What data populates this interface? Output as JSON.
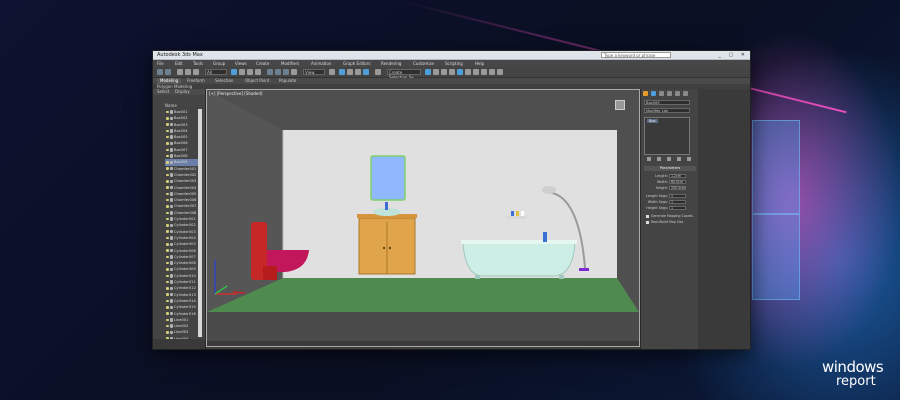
{
  "app": {
    "title": "Autodesk 3ds Max",
    "search_placeholder": "Type a keyword or phrase",
    "window_buttons": "_ ▢ ✕"
  },
  "menubar": [
    "File",
    "Edit",
    "Tools",
    "Group",
    "Views",
    "Create",
    "Modifiers",
    "Animation",
    "Graph Editors",
    "Rendering",
    "Customize",
    "Scripting",
    "Help"
  ],
  "toolbar": {
    "filter_dropdown": "All",
    "view_dropdown": "View",
    "selection_set_dropdown": "Create Selection Se"
  },
  "ribbon": {
    "tabs": [
      "Modeling",
      "Freeform",
      "Selection",
      "Object Paint",
      "Populate"
    ],
    "active": "Modeling",
    "sub": "Polygon Modeling"
  },
  "explorer": {
    "tabs": [
      "Select",
      "Display"
    ],
    "header": "Name",
    "items": [
      "Box001",
      "Box002",
      "Box003",
      "Box004",
      "Box005",
      "Box006",
      "Box007",
      "Box008",
      "Box009",
      "Chamfer001",
      "Chamfer002",
      "Chamfer003",
      "Chamfer004",
      "Chamfer005",
      "Chamfer006",
      "Chamfer007",
      "Chamfer008",
      "Cylinder001",
      "Cylinder002",
      "Cylinder003",
      "Cylinder004",
      "Cylinder005",
      "Cylinder006",
      "Cylinder007",
      "Cylinder008",
      "Cylinder009",
      "Cylinder010",
      "Cylinder011",
      "Cylinder012",
      "Cylinder013",
      "Cylinder014",
      "Cylinder015",
      "Cylinder016",
      "Line001",
      "Line002",
      "Line003",
      "Line004",
      "Plane001",
      "Plane002"
    ],
    "selected_index": 8
  },
  "viewport": {
    "label": "[+] [Perspective] [Shaded]"
  },
  "command_panel": {
    "object_name": "Box009",
    "modifier_list": "Modifier List",
    "stack_item": "Box",
    "parameters_title": "Parameters",
    "params": [
      {
        "label": "Length:",
        "value": "1.2cm"
      },
      {
        "label": "Width:",
        "value": "60.0cm"
      },
      {
        "label": "Height:",
        "value": "200.0cm"
      },
      {
        "label": "Length Segs:",
        "value": "1"
      },
      {
        "label": "Width Segs:",
        "value": "1"
      },
      {
        "label": "Height Segs:",
        "value": "1"
      }
    ],
    "checks": [
      "Generate Mapping Coords.",
      "Real-World Map Size"
    ]
  },
  "brand": {
    "line1": "windows",
    "line2": "report"
  },
  "colors": {
    "viewport_bg": "#4f4f4f",
    "wall": "#e0e0e0",
    "floor": "#4f8a4f",
    "toilet": "#c62828",
    "toilet_bowl": "#c2185b",
    "cabinet": "#e0a54a",
    "mirror": "#8fb8ff",
    "bathtub": "#cdeee4",
    "selection": "#6b7ea8"
  }
}
